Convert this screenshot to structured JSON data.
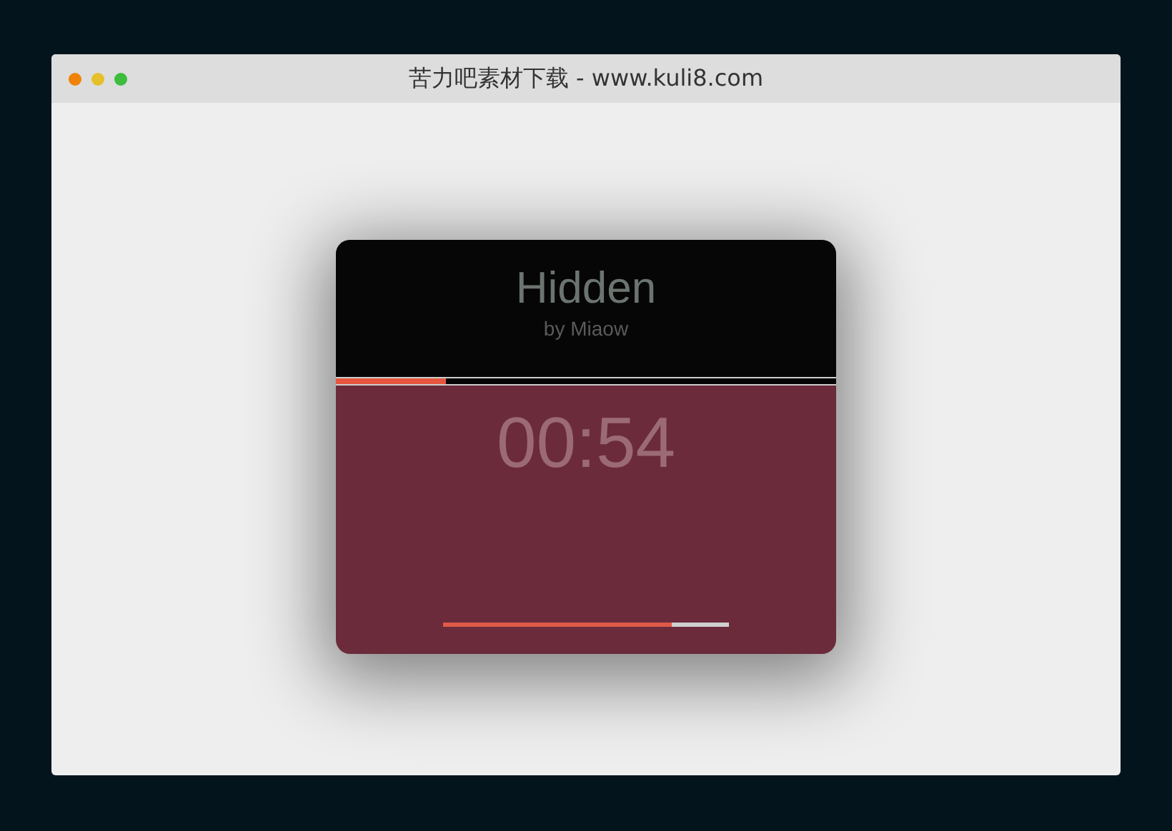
{
  "window": {
    "title": "苦力吧素材下载 - www.kuli8.com"
  },
  "player": {
    "title": "Hidden",
    "artist": "by Miaow",
    "progress": {
      "level": 0.22
    },
    "time": "00:54",
    "volume": {
      "level": 0.8
    }
  }
}
